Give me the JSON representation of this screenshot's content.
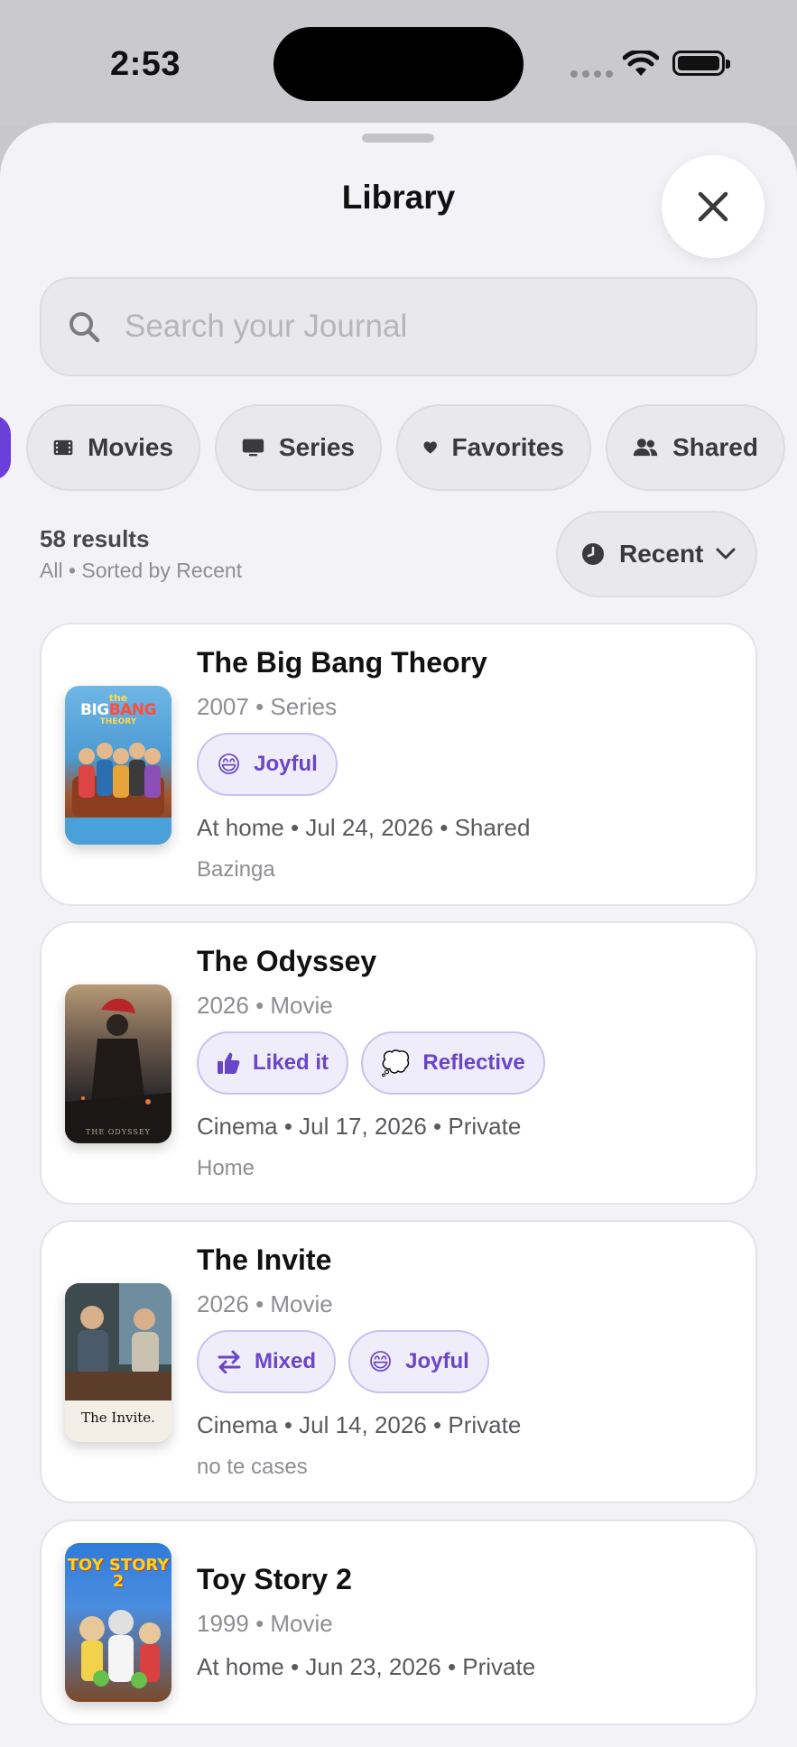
{
  "status": {
    "time": "2:53"
  },
  "sheet": {
    "title": "Library"
  },
  "search": {
    "placeholder": "Search your Journal"
  },
  "filters": [
    "Movies",
    "Series",
    "Favorites",
    "Shared"
  ],
  "results": {
    "count": "58 results",
    "subtitle": "All • Sorted by Recent",
    "sort_label": "Recent"
  },
  "entries": [
    {
      "title": "The Big Bang Theory",
      "meta": "2007 • Series",
      "tags": [
        {
          "icon": "grinning-emoji",
          "emoji": "😄",
          "label": "Joyful"
        }
      ],
      "details": "At home • Jul 24, 2026 • Shared",
      "note": "Bazinga",
      "poster_text": "the BIG BANG THEORY"
    },
    {
      "title": "The Odyssey",
      "meta": "2026 • Movie",
      "tags": [
        {
          "icon": "thumbs-up-icon",
          "label": "Liked it"
        },
        {
          "icon": "thought-bubble-emoji",
          "emoji": "💭",
          "label": "Reflective"
        }
      ],
      "details": "Cinema • Jul 17, 2026 • Private",
      "note": "Home",
      "poster_text": "THE ODYSSEY"
    },
    {
      "title": "The Invite",
      "meta": "2026 • Movie",
      "tags": [
        {
          "icon": "mixed-arrows-icon",
          "label": "Mixed"
        },
        {
          "icon": "grinning-emoji",
          "emoji": "😄",
          "label": "Joyful"
        }
      ],
      "details": "Cinema • Jul 14, 2026 • Private",
      "note": "no te cases",
      "poster_text": "The Invite."
    },
    {
      "title": "Toy Story 2",
      "meta": "1999 • Movie",
      "details": "At home • Jun 23, 2026 • Private",
      "poster_text": "TOY STORY 2"
    }
  ],
  "colors": {
    "accent": "#6b45c8",
    "background": "#f2f2f7"
  }
}
